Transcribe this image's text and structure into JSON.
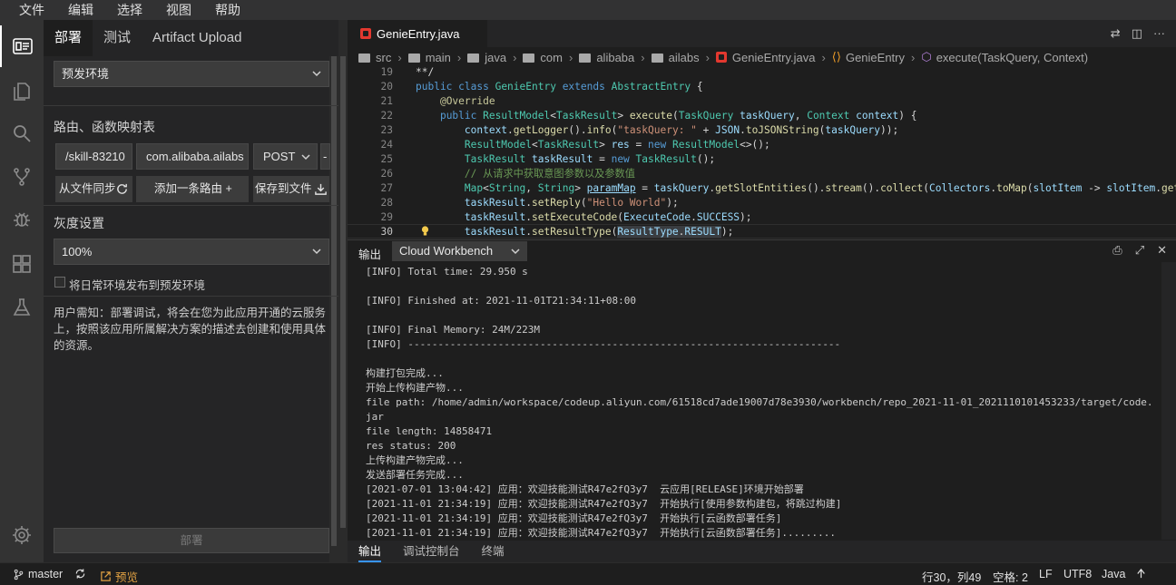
{
  "menu": [
    "文件",
    "编辑",
    "选择",
    "视图",
    "帮助"
  ],
  "activity_icons": [
    "deploy-panel-icon",
    "files-icon",
    "search-icon",
    "source-control-icon",
    "debug-icon",
    "extensions-icon",
    "flask-icon",
    "settings-gear-icon"
  ],
  "sidebar": {
    "tabs": [
      "部署",
      "测试",
      "Artifact Upload"
    ],
    "env_select": "预发环境",
    "route_title": "路由、函数映射表",
    "route": {
      "path": "/skill-83210",
      "class": "com.alibaba.ailabs",
      "method": "POST",
      "extra": "-"
    },
    "buttons": {
      "sync": "从文件同步",
      "add": "添加一条路由 +",
      "save": "保存到文件"
    },
    "gray_title": "灰度设置",
    "gray_select": "100%",
    "checkbox_label": "将日常环境发布到预发环境",
    "notice": "用户需知：部署调试，将会在您为此应用开通的云服务上，按照该应用所属解决方案的描述去创建和使用具体的资源。",
    "deploy_button": "部署"
  },
  "editor": {
    "tab": "GenieEntry.java",
    "breadcrumb": [
      "src",
      "main",
      "java",
      "com",
      "alibaba",
      "ailabs",
      "GenieEntry.java",
      "GenieEntry",
      "execute(TaskQuery, Context)"
    ],
    "current_line": 30
  },
  "panel": {
    "title": "输出",
    "channel": "Cloud Workbench",
    "lines": [
      "[INFO] Total time: 29.950 s",
      "",
      "[INFO] Finished at: 2021-11-01T21:34:11+08:00",
      "",
      "[INFO] Final Memory: 24M/223M",
      "[INFO] ------------------------------------------------------------------------",
      "",
      "构建打包完成...",
      "开始上传构建产物...",
      "file path: /home/admin/workspace/codeup.aliyun.com/61518cd7ade19007d78e3930/workbench/repo_2021-11-01_2021110101453233/target/code.",
      "jar",
      "file length: 14858471",
      "res status: 200",
      "上传构建产物完成...",
      "发送部署任务完成...",
      "[2021-07-01 13:04:42] 应用：欢迎技能测试R47e2fQ3y7  云应用[RELEASE]环境开始部署",
      "[2021-11-01 21:34:19] 应用：欢迎技能测试R47e2fQ3y7  开始执行[使用参数构建包，将跳过构建]",
      "[2021-11-01 21:34:19] 应用：欢迎技能测试R47e2fQ3y7  开始执行[云函数部署任务]",
      "[2021-11-01 21:34:19] 应用：欢迎技能测试R47e2fQ3y7  开始执行[云函数部署任务]........."
    ],
    "bottom_tabs": [
      "输出",
      "调试控制台",
      "终端"
    ]
  },
  "status": {
    "branch": "master",
    "preview": "预览",
    "position": "行30，列49",
    "spaces": "空格: 2",
    "eol": "LF",
    "encoding": "UTF8",
    "language": "Java"
  }
}
